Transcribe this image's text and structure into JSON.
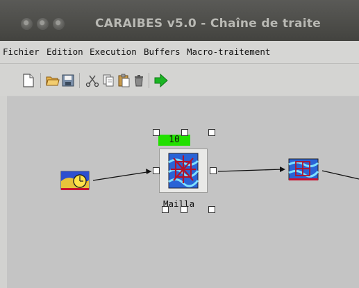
{
  "window": {
    "title": "CARAIBES v5.0 - Chaîne de traite"
  },
  "menubar": {
    "items": [
      "Fichier",
      "Edition",
      "Execution",
      "Buffers",
      "Macro-traitement"
    ]
  },
  "toolbar": {
    "buttons": [
      "new-file-icon",
      "open-folder-icon",
      "save-icon",
      "cut-icon",
      "copy-icon",
      "paste-icon",
      "delete-icon",
      "run-icon"
    ]
  },
  "canvas": {
    "nodes": [
      {
        "icon": "source-clock-icon"
      },
      {
        "icon": "maillage-icon",
        "label": "Mailla",
        "counter": "10",
        "selected": true
      },
      {
        "icon": "grid-output-icon"
      }
    ]
  },
  "colors": {
    "counter": "#22e000",
    "run": "#1bb524",
    "canvas": "#c4c4c4"
  }
}
